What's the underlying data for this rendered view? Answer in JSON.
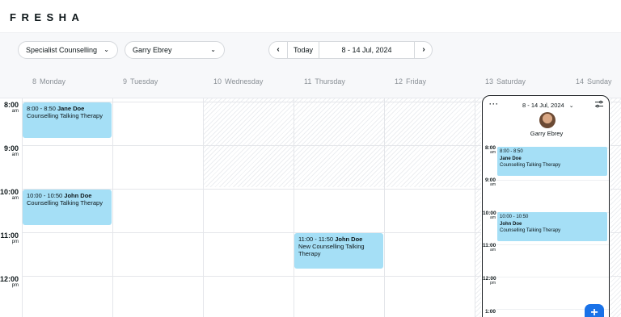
{
  "brand": {
    "logo_text": "FRESHA"
  },
  "toolbar": {
    "service_filter": "Specialist Counselling",
    "staff_filter": "Garry Ebrey",
    "prev_label": "‹",
    "today_label": "Today",
    "date_range": "8 - 14 Jul, 2024",
    "next_label": "›"
  },
  "days": [
    {
      "num": "8",
      "name": "Monday"
    },
    {
      "num": "9",
      "name": "Tuesday"
    },
    {
      "num": "10",
      "name": "Wednesday"
    },
    {
      "num": "11",
      "name": "Thursday"
    },
    {
      "num": "12",
      "name": "Friday"
    },
    {
      "num": "13",
      "name": "Saturday"
    },
    {
      "num": "14",
      "name": "Sunday"
    }
  ],
  "times": [
    {
      "hour": "8:00",
      "ampm": "am"
    },
    {
      "hour": "9:00",
      "ampm": "am"
    },
    {
      "hour": "10:00",
      "ampm": "am"
    },
    {
      "hour": "11:00",
      "ampm": "pm"
    },
    {
      "hour": "12:00",
      "ampm": "pm"
    }
  ],
  "appointments": [
    {
      "time": "8:00 - 8:50",
      "client": "Jane Doe",
      "service": "Counselling Talking Therapy"
    },
    {
      "time": "10:00 - 10:50",
      "client": "John Doe",
      "service": "Counselling Talking Therapy"
    },
    {
      "time": "11:00 - 11:50",
      "client": "John Doe",
      "service": "New Counselling Talking Therapy"
    }
  ],
  "mobile": {
    "menu_label": "···",
    "date_range": "8 - 14 Jul, 2024",
    "staff_name": "Garry Ebrey",
    "times": [
      {
        "hour": "8:00",
        "ampm": "am"
      },
      {
        "hour": "9:00",
        "ampm": "am"
      },
      {
        "hour": "10:00",
        "ampm": "am"
      },
      {
        "hour": "11:00",
        "ampm": "am"
      },
      {
        "hour": "12:00",
        "ampm": "pm"
      },
      {
        "hour": "1:00",
        "ampm": ""
      }
    ],
    "appointments": [
      {
        "time": "8:00 - 8:50",
        "client": "Jane Doe",
        "service": "Counselling Talking Therapy"
      },
      {
        "time": "10:00 - 10:50",
        "client": "John Doe",
        "service": "Counselling Talking Therapy"
      }
    ],
    "fab_label": "+"
  },
  "colors": {
    "appointment": "#a5dff6",
    "accent": "#1a72e8",
    "background": "#f7f8fa"
  },
  "icons": [
    "chevron-down-icon",
    "chevron-left-icon",
    "chevron-right-icon",
    "more-icon",
    "filter-icon",
    "plus-icon"
  ]
}
